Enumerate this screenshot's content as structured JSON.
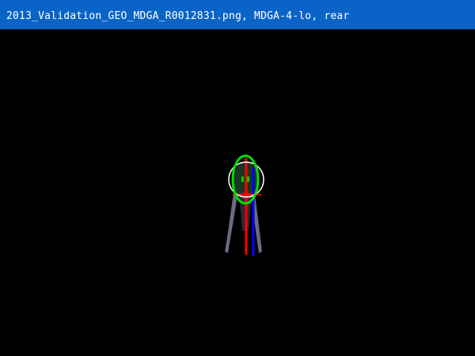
{
  "window": {
    "title": "2013_Validation_GEO_MDGA_R0012831.png, MDGA-4-lo, rear"
  },
  "colors": {
    "title_bar": "#0a64c8",
    "background": "#000000",
    "ellipse_fit": "#00dd00",
    "circle_outline": "#ffffff",
    "axis_vertical_red": "#ff0000",
    "axis_vertical_blue": "#0000ff",
    "marker": "#00cc00"
  }
}
